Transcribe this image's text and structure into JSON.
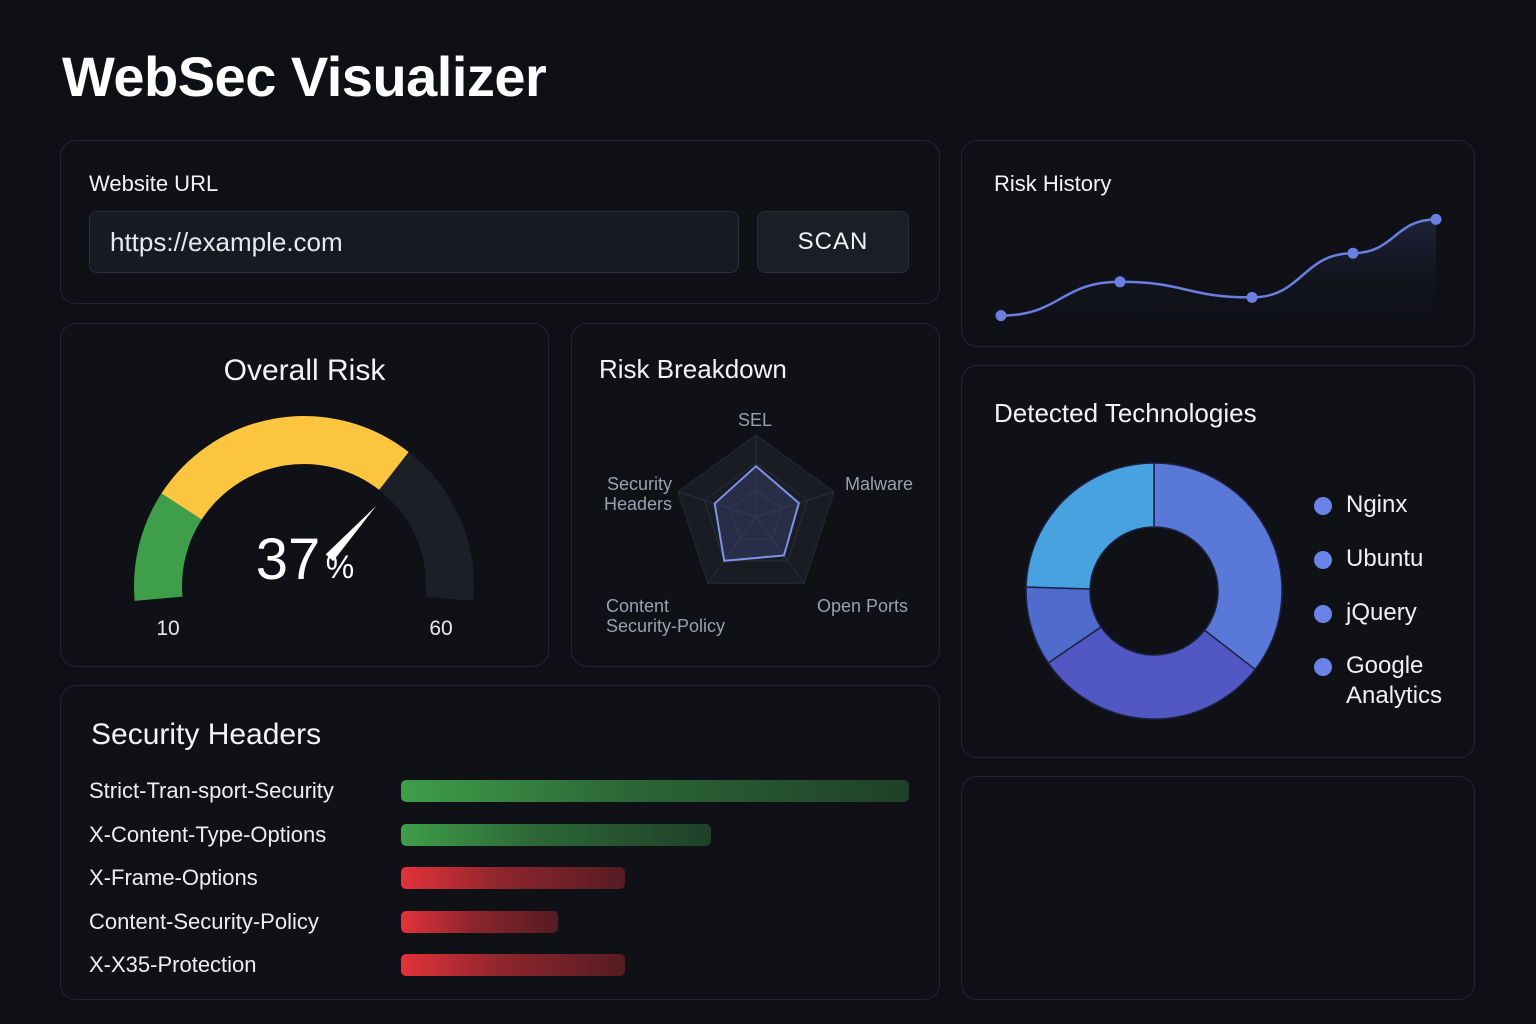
{
  "app": {
    "title": "WebSec Visualizer"
  },
  "url_panel": {
    "label": "Website URL",
    "input_value": "https://example.com",
    "scan_label": "SCAN"
  },
  "overall_risk": {
    "title": "Overall Risk",
    "value_number": "37",
    "value_unit": "%",
    "value": 37,
    "min_label": "10",
    "max_label": "60",
    "colors": {
      "low": "#3f9e4a",
      "mid": "#fbc53f",
      "rest": "#1c1f26"
    }
  },
  "risk_breakdown": {
    "title": "Risk Breakdown",
    "axes": [
      "SEL",
      "Malware",
      "Open Ports",
      "Content Security-Policy",
      "Security Headers"
    ],
    "axis_lines": [
      [
        "SEL"
      ],
      [
        "Malware"
      ],
      [
        "Open Ports"
      ],
      [
        "Content",
        "Security-Policy"
      ],
      [
        "Security",
        "Headers"
      ]
    ],
    "values": [
      0.62,
      0.55,
      0.58,
      0.66,
      0.53
    ],
    "color": "#7f93e8"
  },
  "security_headers": {
    "title": "Security Headers",
    "items": [
      {
        "label": "Strict-Tran-sport-Security",
        "score": 1.0,
        "status": "good"
      },
      {
        "label": "X-Content-Type-Options",
        "score": 0.61,
        "status": "good"
      },
      {
        "label": "X-Frame-Options",
        "score": 0.44,
        "status": "bad"
      },
      {
        "label": "Content-Security-Policy",
        "score": 0.31,
        "status": "bad"
      },
      {
        "label": "X-X35-Protection",
        "score": 0.44,
        "status": "bad"
      }
    ],
    "colors": {
      "good": "#3f9e4a",
      "bad": "#e3323a"
    }
  },
  "risk_history": {
    "title": "Risk History",
    "color": "#6a7fe0"
  },
  "chart_data": [
    {
      "type": "line",
      "title": "Risk History",
      "x": [
        1,
        2,
        3,
        4,
        5
      ],
      "series": [
        {
          "values": [
            8,
            34,
            22,
            56,
            82
          ]
        }
      ],
      "ylim": [
        0,
        100
      ],
      "grid": false
    },
    {
      "type": "pie",
      "title": "Detected Technologies",
      "categories": [
        "Nginx",
        "Ubuntu",
        "jQuery",
        "Google Analytics"
      ],
      "values": [
        35.5,
        30,
        10,
        24.5
      ],
      "colors": [
        "#5a78d8",
        "#5158c4",
        "#4f6bcc",
        "#47a2df"
      ],
      "legend": "right"
    }
  ],
  "detected_technologies": {
    "title": "Detected Technologies",
    "legend": [
      {
        "label": "Nginx"
      },
      {
        "label": "Ubuntu"
      },
      {
        "label": "jQuery"
      },
      {
        "label": "Google Analytics"
      }
    ],
    "legend_color": "#6b82e6"
  }
}
